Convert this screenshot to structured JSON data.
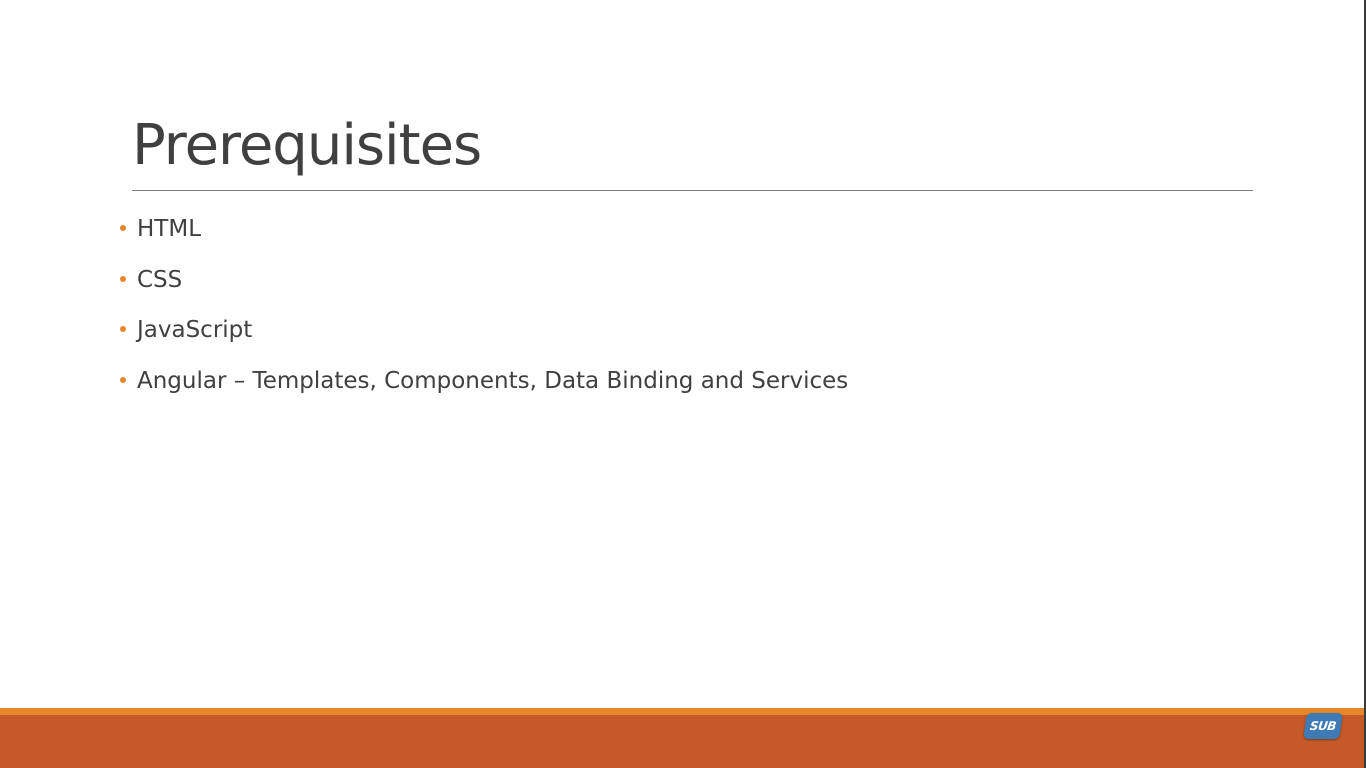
{
  "slide": {
    "title": "Prerequisites",
    "bullets": [
      "HTML",
      "CSS",
      "JavaScript",
      "Angular – Templates, Components, Data Binding and Services"
    ]
  },
  "badge": {
    "label": "SUB",
    "icon": "subscribe-badge-icon"
  },
  "colors": {
    "title_text": "#404040",
    "body_text": "#404040",
    "rule": "#7f7f7f",
    "bullet_dot": "#e8862a",
    "footer_strip": "#e8862a",
    "footer_band": "#c55a28",
    "badge_bg": "#3e7bb6"
  }
}
